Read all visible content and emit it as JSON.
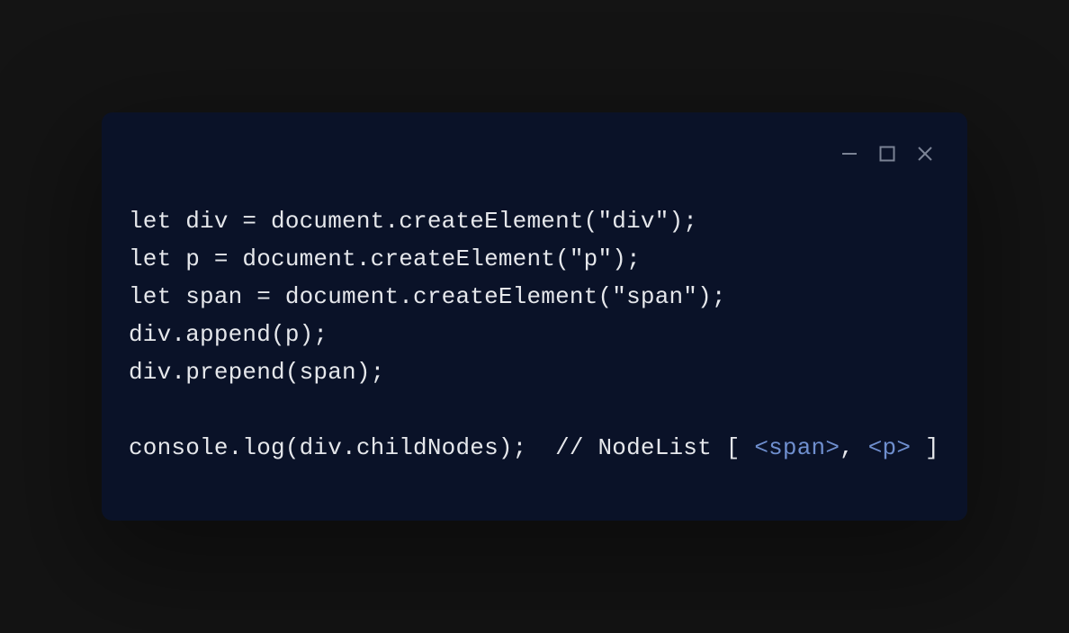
{
  "colors": {
    "background": "#141414",
    "panel": "#0a1228",
    "text": "#e5e7eb",
    "control": "#7b8395",
    "tag_highlight": "#6f8fcf"
  },
  "code": {
    "lines": [
      {
        "tokens": [
          {
            "t": "let div = document.createElement(\"div\");",
            "c": "plain"
          }
        ]
      },
      {
        "tokens": [
          {
            "t": "let p = document.createElement(\"p\");",
            "c": "plain"
          }
        ]
      },
      {
        "tokens": [
          {
            "t": "let span = document.createElement(\"span\");",
            "c": "plain"
          }
        ]
      },
      {
        "tokens": [
          {
            "t": "div.append(p);",
            "c": "plain"
          }
        ]
      },
      {
        "tokens": [
          {
            "t": "div.prepend(span);",
            "c": "plain"
          }
        ]
      },
      {
        "tokens": [
          {
            "t": "",
            "c": "plain"
          }
        ]
      },
      {
        "tokens": [
          {
            "t": "console.log(div.childNodes);  // NodeList [ ",
            "c": "plain"
          },
          {
            "t": "<span>",
            "c": "tag"
          },
          {
            "t": ", ",
            "c": "plain"
          },
          {
            "t": "<p>",
            "c": "tag"
          },
          {
            "t": " ]",
            "c": "plain"
          }
        ]
      }
    ]
  }
}
